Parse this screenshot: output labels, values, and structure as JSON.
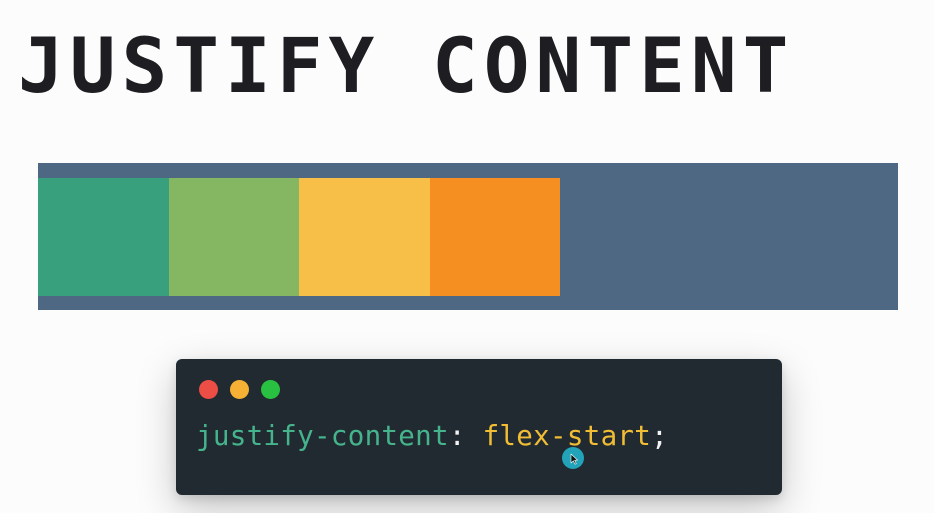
{
  "heading": {
    "title": "JUSTIFY CONTENT"
  },
  "demo": {
    "justify_content": "flex-start",
    "container_color": "#4e6782",
    "items": [
      {
        "color": "#39a07d"
      },
      {
        "color": "#85b662"
      },
      {
        "color": "#f7bf48"
      },
      {
        "color": "#f58f21"
      }
    ]
  },
  "code_window": {
    "background": "#202a30",
    "traffic_lights": [
      {
        "icon": "close-dot-icon",
        "color": "#ec4d45"
      },
      {
        "icon": "minimize-dot-icon",
        "color": "#f6b033"
      },
      {
        "icon": "maximize-dot-icon",
        "color": "#29c141"
      }
    ],
    "code": {
      "property": "justify-content",
      "colon": ":",
      "value": "flex-start",
      "semicolon": ";",
      "property_color": "#45b48c",
      "value_color": "#f1bd35",
      "punctuation_color": "#f2f2f2"
    }
  },
  "cursor": {
    "icon": "mouse-pointer-icon",
    "highlight_color": "#22a3b9"
  }
}
